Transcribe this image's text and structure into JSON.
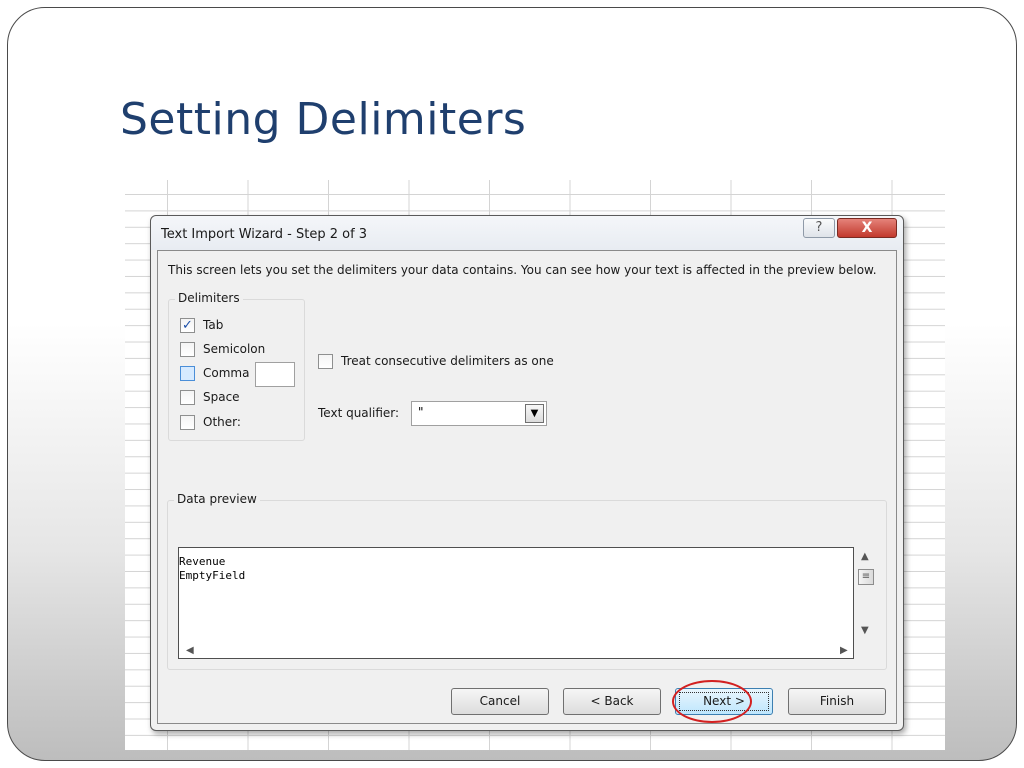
{
  "slide": {
    "title": "Setting Delimiters"
  },
  "dialog": {
    "title": "Text Import Wizard - Step 2 of 3",
    "help_glyph": "?",
    "close_glyph": "X",
    "description": "This screen lets you set the delimiters your data contains.  You can see how your text is affected in the preview below.",
    "delimiters": {
      "label": "Delimiters",
      "items": [
        {
          "label": "Tab",
          "checked": true
        },
        {
          "label": "Semicolon",
          "checked": false
        },
        {
          "label": "Comma",
          "checked": false
        },
        {
          "label": "Space",
          "checked": false
        },
        {
          "label": "Other:",
          "checked": false
        }
      ],
      "other_value": ""
    },
    "treat_consecutive": {
      "label": "Treat consecutive delimiters as one",
      "checked": false
    },
    "text_qualifier": {
      "label": "Text qualifier:",
      "value": "\""
    },
    "data_preview": {
      "label": "Data preview",
      "lines": [
        "Revenue",
        "EmptyField"
      ]
    },
    "buttons": {
      "cancel": "Cancel",
      "back": "< Back",
      "next": "Next >",
      "finish": "Finish"
    }
  }
}
